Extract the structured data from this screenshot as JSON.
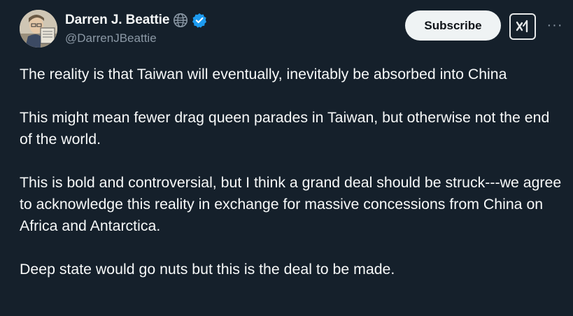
{
  "author": {
    "display_name": "Darren J. Beattie",
    "handle": "@DarrenJBeattie",
    "affiliation_icon": "globe-icon",
    "verified_icon": "verified-badge-icon"
  },
  "actions": {
    "subscribe_label": "Subscribe",
    "grok_icon": "grok-icon",
    "more_icon": "more-icon",
    "more_glyph": "···"
  },
  "tweet": {
    "paragraphs": [
      "The reality is that Taiwan will eventually, inevitably be absorbed into China",
      "This might mean fewer drag queen parades in Taiwan, but otherwise not the end of the world.",
      "This is bold and controversial, but I think a grand deal should be struck---we agree to acknowledge this reality in exchange for massive concessions from China on Africa and Antarctica.",
      "Deep state would go nuts but this is the deal to be made."
    ]
  },
  "colors": {
    "background": "#15202b",
    "text": "#f7f9f9",
    "secondary_text": "#8b98a5",
    "verified_blue": "#1d9bf0",
    "button_bg": "#eff3f4"
  }
}
